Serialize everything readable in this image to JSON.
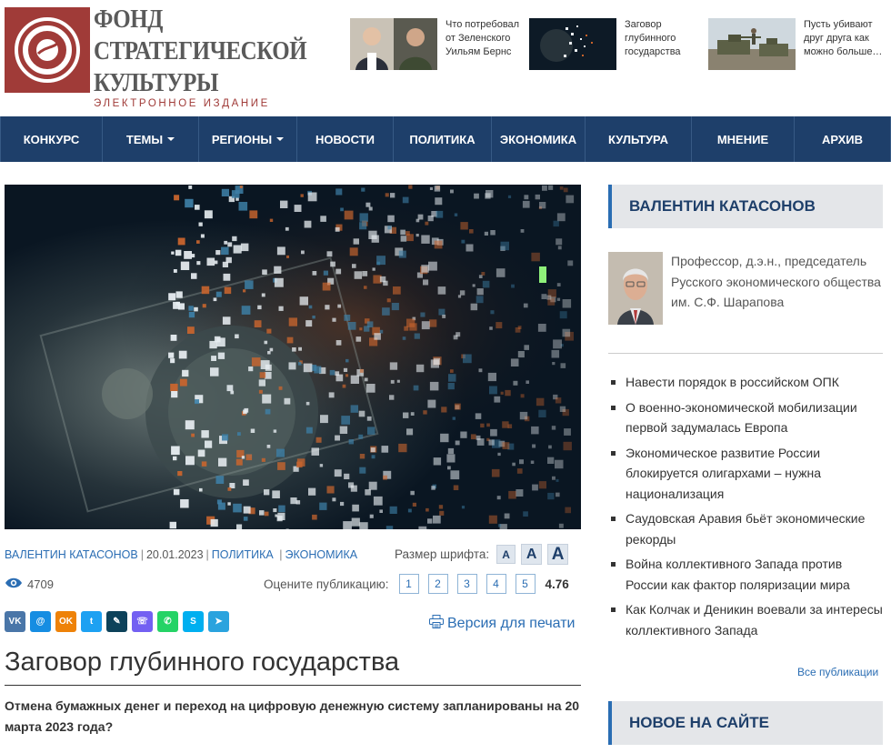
{
  "header": {
    "logo_line1": "ФОНД",
    "logo_line2": "СТРАТЕГИЧЕСКОЙ",
    "logo_line3": "КУЛЬТУРЫ",
    "logo_sub": "ЭЛЕКТРОННОЕ ИЗДАНИЕ",
    "teasers": [
      {
        "text": "Что потребовал от Зеленского Уильям Бернс"
      },
      {
        "text": "Заговор глубинного государства"
      },
      {
        "text": "Пусть убивают друг друга как можно больше…"
      }
    ]
  },
  "nav": {
    "items": [
      {
        "label": "КОНКУРС"
      },
      {
        "label": "ТЕМЫ"
      },
      {
        "label": "РЕГИОНЫ"
      },
      {
        "label": "НОВОСТИ"
      },
      {
        "label": "ПОЛИТИКА"
      },
      {
        "label": "ЭКОНОМИКА"
      },
      {
        "label": "КУЛЬТУРА"
      },
      {
        "label": "МНЕНИЕ"
      },
      {
        "label": "АРХИВ"
      }
    ]
  },
  "article": {
    "author": "ВАЛЕНТИН КАТАСОНОВ",
    "date": "20.01.2023",
    "category1": "ПОЛИТИКА",
    "category2": "ЭКОНОМИКА",
    "font_size_label": "Размер шрифта:",
    "font_btn_small": "A",
    "font_btn_medium": "A",
    "font_btn_large": "A",
    "views": "4709",
    "rate_label": "Оцените публикацию:",
    "rate_options": [
      "1",
      "2",
      "3",
      "4",
      "5"
    ],
    "rating": "4.76",
    "print_label": "Версия для печати",
    "title": "Заговор глубинного государства",
    "lead": "Отмена бумажных денег и переход на цифровую денежную систему запланированы на 20 марта 2023 года?"
  },
  "shares": [
    {
      "icon": "vk-icon",
      "color": "#4a76a8",
      "glyph": "VK"
    },
    {
      "icon": "mail-icon",
      "color": "#168de2",
      "glyph": "@"
    },
    {
      "icon": "odnoklassniki-icon",
      "color": "#ee8208",
      "glyph": "OK"
    },
    {
      "icon": "twitter-icon",
      "color": "#1da1f2",
      "glyph": "t"
    },
    {
      "icon": "livejournal-icon",
      "color": "#0d425a",
      "glyph": "✎"
    },
    {
      "icon": "viber-icon",
      "color": "#7360f2",
      "glyph": "☏"
    },
    {
      "icon": "whatsapp-icon",
      "color": "#25d366",
      "glyph": "✆"
    },
    {
      "icon": "skype-icon",
      "color": "#00aff0",
      "glyph": "S"
    },
    {
      "icon": "telegram-icon",
      "color": "#2aa3de",
      "glyph": "➤"
    }
  ],
  "sidebar": {
    "author_heading": "ВАЛЕНТИН КАТАСОНОВ",
    "author_description": "Профессор, д.э.н., председатель Русского экономического общества им. С.Ф. Шарапова",
    "articles": [
      "Навести порядок в российском ОПК",
      "О военно-экономической мобилизации первой задумалась Европа",
      "Экономическое развитие России блокируется олигархами – нужна национализация",
      "Саудовская Аравия бьёт экономические рекорды",
      "Война коллективного Запада против России как фактор поляризации мира",
      "Как Колчак и Деникин воевали за интересы коллективного Запада"
    ],
    "all_publications": "Все публикации",
    "new_heading": "НОВОЕ НА САЙТЕ"
  },
  "colors": {
    "brand_red": "#a03b38",
    "nav_blue": "#1e3f6a",
    "link_blue": "#2a6db3"
  }
}
